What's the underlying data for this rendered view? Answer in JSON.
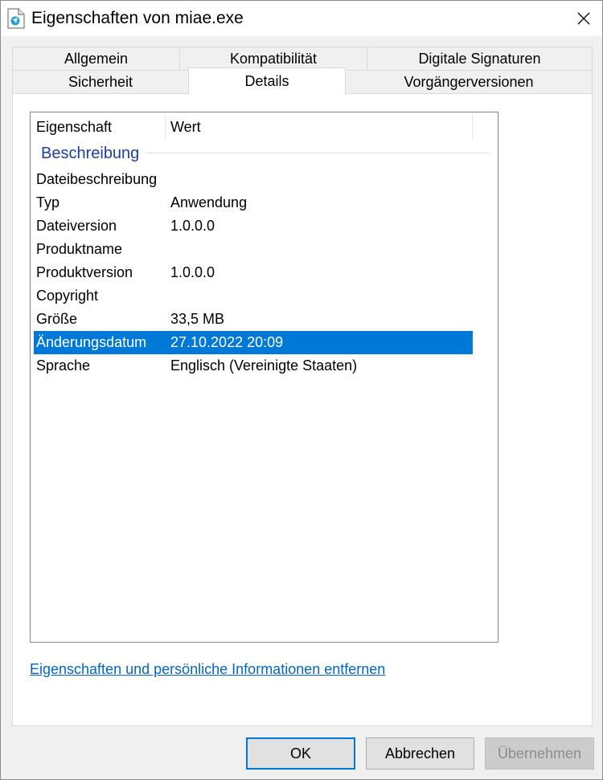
{
  "window": {
    "title": "Eigenschaften von miae.exe",
    "icon": "exe-file-icon",
    "close_icon": "close-icon"
  },
  "tabs": {
    "row1": [
      "Allgemein",
      "Kompatibilität",
      "Digitale Signaturen"
    ],
    "row2": [
      "Sicherheit",
      "Details",
      "Vorgängerversionen"
    ],
    "active": "Details"
  },
  "details": {
    "columns": {
      "property": "Eigenschaft",
      "value": "Wert"
    },
    "group": "Beschreibung",
    "rows": [
      {
        "property": "Dateibeschreibung",
        "value": ""
      },
      {
        "property": "Typ",
        "value": "Anwendung"
      },
      {
        "property": "Dateiversion",
        "value": "1.0.0.0"
      },
      {
        "property": "Produktname",
        "value": ""
      },
      {
        "property": "Produktversion",
        "value": "1.0.0.0"
      },
      {
        "property": "Copyright",
        "value": ""
      },
      {
        "property": "Größe",
        "value": "33,5 MB"
      },
      {
        "property": "Änderungsdatum",
        "value": "27.10.2022 20:09"
      },
      {
        "property": "Sprache",
        "value": "Englisch (Vereinigte Staaten)"
      }
    ],
    "selected_row": "Änderungsdatum",
    "remove_link": "Eigenschaften und persönliche Informationen entfernen"
  },
  "buttons": {
    "ok": "OK",
    "cancel": "Abbrechen",
    "apply": "Übernehmen"
  },
  "colors": {
    "selection": "#0078d7",
    "link": "#0066cc",
    "group_header": "#1e3f9e"
  }
}
